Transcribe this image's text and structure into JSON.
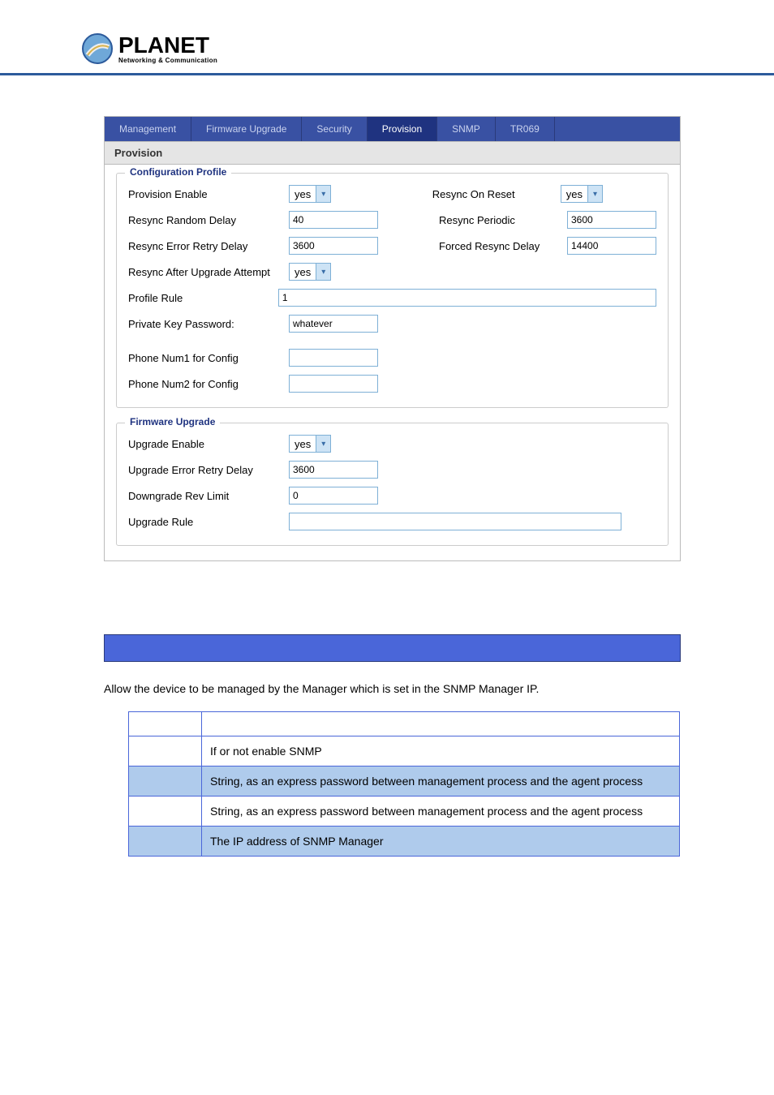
{
  "logo": {
    "name": "PLANET",
    "tagline": "Networking & Communication"
  },
  "tabs": [
    "Management",
    "Firmware Upgrade",
    "Security",
    "Provision",
    "SNMP",
    "TR069"
  ],
  "section_title": "Provision",
  "config_profile": {
    "legend": "Configuration Profile",
    "left": {
      "provision_enable_lbl": "Provision Enable",
      "provision_enable_val": "yes",
      "resync_random_delay_lbl": "Resync Random Delay",
      "resync_random_delay_val": "40",
      "resync_error_retry_lbl": "Resync Error Retry Delay",
      "resync_error_retry_val": "3600",
      "resync_after_upgrade_lbl": "Resync After Upgrade Attempt",
      "resync_after_upgrade_val": "yes",
      "profile_rule_lbl": "Profile Rule",
      "profile_rule_val": "1",
      "priv_key_lbl": "Private Key Password:",
      "priv_key_val": "whatever",
      "phone1_lbl": "Phone Num1 for Config",
      "phone1_val": "",
      "phone2_lbl": "Phone Num2 for Config",
      "phone2_val": ""
    },
    "right": {
      "resync_on_reset_lbl": "Resync On Reset",
      "resync_on_reset_val": "yes",
      "resync_periodic_lbl": "Resync Periodic",
      "resync_periodic_val": "3600",
      "forced_resync_lbl": "Forced Resync Delay",
      "forced_resync_val": "14400"
    }
  },
  "fw_upgrade": {
    "legend": "Firmware Upgrade",
    "upgrade_enable_lbl": "Upgrade Enable",
    "upgrade_enable_val": "yes",
    "upgrade_error_retry_lbl": "Upgrade Error Retry Delay",
    "upgrade_error_retry_val": "3600",
    "downgrade_rev_lbl": "Downgrade Rev Limit",
    "downgrade_rev_val": "0",
    "upgrade_rule_lbl": "Upgrade Rule",
    "upgrade_rule_val": ""
  },
  "intro": "Allow the device to be managed by the Manager which is set in the SNMP Manager IP.",
  "table": {
    "r1": "If or not enable SNMP",
    "r2": "String, as an express password between management process and the agent process",
    "r3": "String, as an express password between management process and the agent process",
    "r4": "The IP address of SNMP Manager"
  }
}
